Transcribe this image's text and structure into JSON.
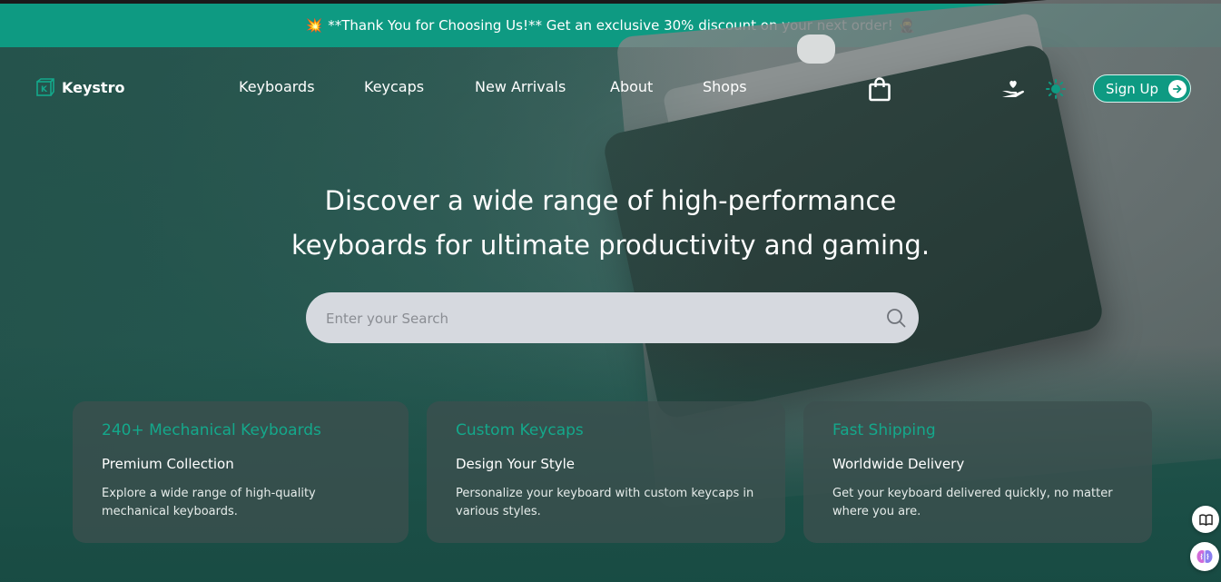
{
  "promo": {
    "left_emoji": "💥",
    "text": "**Thank You for Choosing Us!** Get an exclusive 30% discount on your next order!",
    "right_emoji": "🥷",
    "background": "#0e9a82"
  },
  "brand": {
    "name": "Keystro",
    "accent": "#14a88b"
  },
  "nav": {
    "items": [
      "Keyboards",
      "Keycaps",
      "New Arrivals",
      "About",
      "Shops"
    ]
  },
  "header_actions": {
    "cart_icon": "shopping-bag-icon",
    "care_icon": "hand-heart-icon",
    "theme_icon": "sun-icon",
    "signup_label": "Sign Up",
    "signup_arrow_icon": "arrow-right-icon"
  },
  "hero": {
    "headline_line1": "Discover a wide range of high-performance",
    "headline_line2": "keyboards for ultimate productivity and gaming."
  },
  "search": {
    "placeholder": "Enter your Search",
    "value": "",
    "icon": "search-icon"
  },
  "features": [
    {
      "title": "240+ Mechanical Keyboards",
      "subtitle": "Premium Collection",
      "description": "Explore a wide range of high-quality mechanical keyboards."
    },
    {
      "title": "Custom Keycaps",
      "subtitle": "Design Your Style",
      "description": "Personalize your keyboard with custom keycaps in various styles."
    },
    {
      "title": "Fast Shipping",
      "subtitle": "Worldwide Delivery",
      "description": "Get your keyboard delivered quickly, no matter where you are."
    }
  ],
  "floating": {
    "reader_icon": "book-icon",
    "assistant_icon": "brain-icon"
  }
}
